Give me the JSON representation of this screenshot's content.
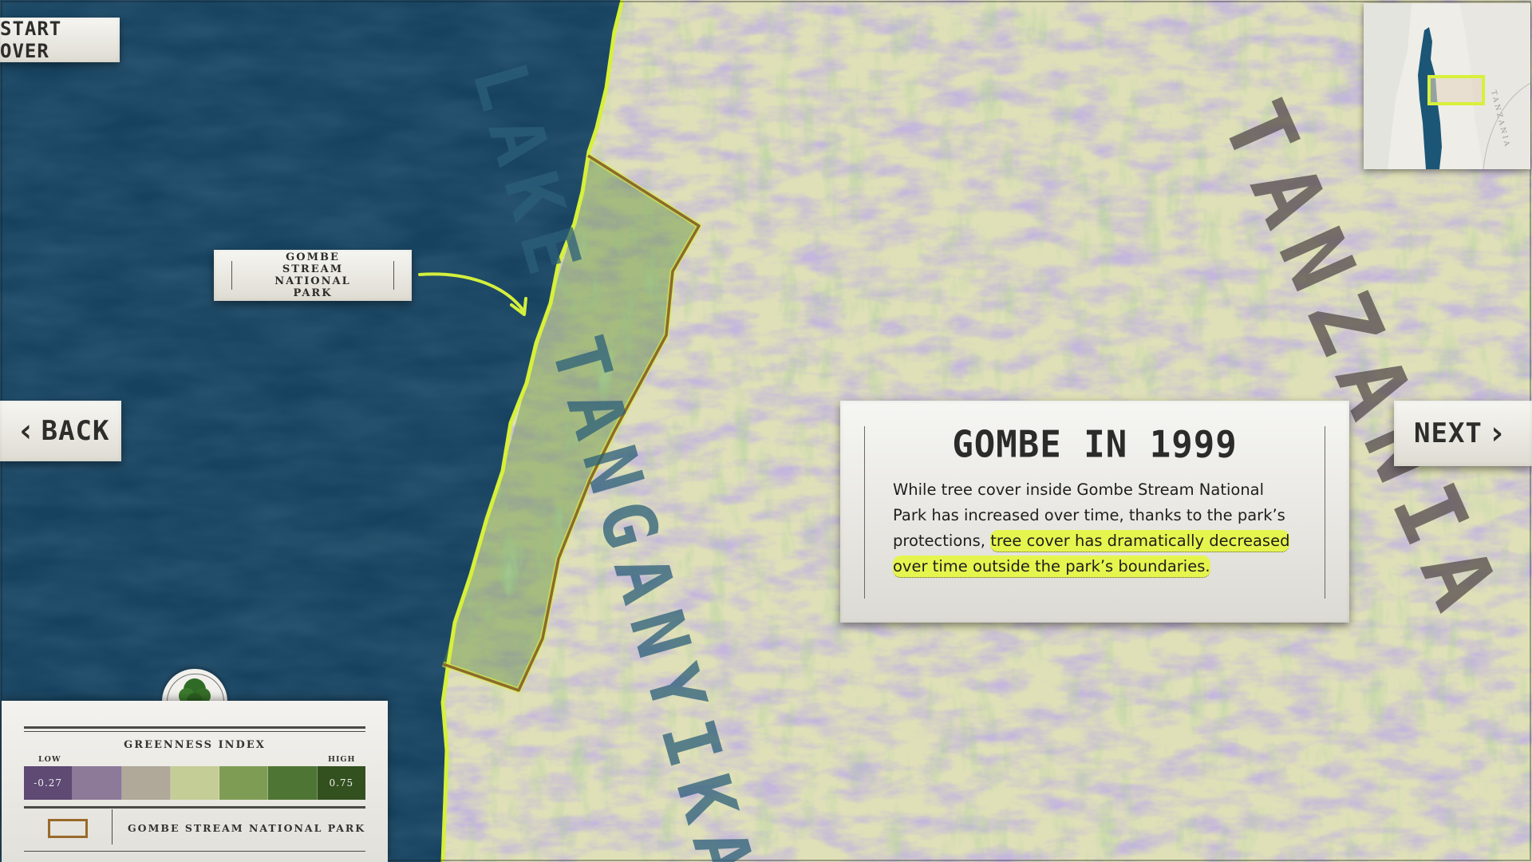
{
  "nav": {
    "start_over": "START OVER",
    "back": "BACK",
    "next": "NEXT"
  },
  "map": {
    "lake_label": "LAKE TANGANYIKA",
    "country_label": "TANZANIA",
    "park_callout": "GOMBE STREAM NATIONAL PARK",
    "colors": {
      "lake": "#16425f",
      "shore_highlight": "#d7f03a",
      "park_boundary": "#8d6a2c",
      "low_greenness": "#8a76b5",
      "high_greenness": "#4e8a36",
      "callout_arrow": "#d4ef3c"
    }
  },
  "info_card": {
    "title": "GOMBE IN 1999",
    "body_plain": "While tree cover inside Gombe Stream National Park has increased over time, thanks to the park’s protections,",
    "body_highlight": "tree cover has dramatically decreased over time outside the park’s boundaries."
  },
  "inset": {
    "country_label": "TANZANIA",
    "colors": {
      "lake": "#1c5676",
      "frame": "#d8f03c"
    }
  },
  "legend": {
    "title": "GREENNESS INDEX",
    "low_label": "LOW",
    "high_label": "HIGH",
    "min_value": "-0.27",
    "max_value": "0.75",
    "ramp_colors": [
      "#5e4a73",
      "#8c7a98",
      "#b0a899",
      "#c4cd96",
      "#7f9c55",
      "#4f7534",
      "#33501f"
    ],
    "park_label": "GOMBE STREAM NATIONAL PARK",
    "park_swatch_color": "#9a6a2b",
    "icon": "tree-icon"
  }
}
